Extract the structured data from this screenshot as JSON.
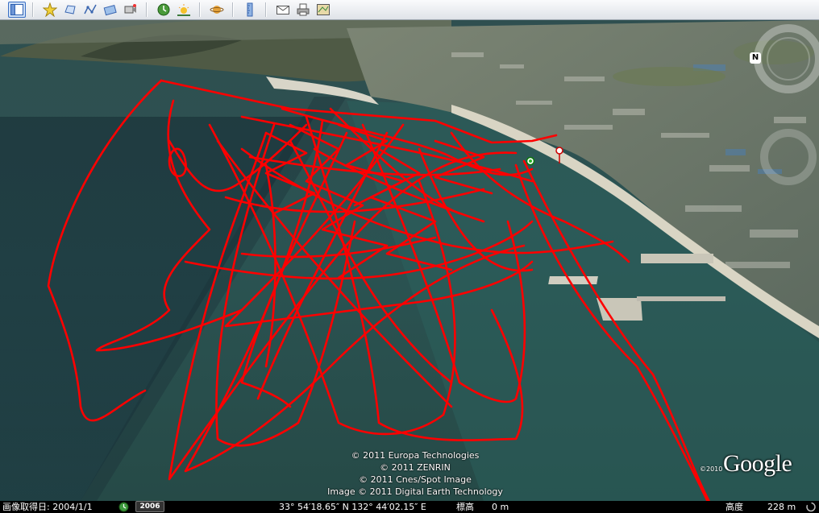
{
  "toolbar": {
    "buttons": [
      {
        "name": "sidebar-toggle-icon"
      },
      {
        "name": "add-placemark-icon"
      },
      {
        "name": "add-polygon-icon"
      },
      {
        "name": "add-path-icon"
      },
      {
        "name": "add-image-overlay-icon"
      },
      {
        "name": "record-tour-icon"
      },
      {
        "name": "historical-imagery-icon"
      },
      {
        "name": "sunlight-icon"
      },
      {
        "name": "planets-icon"
      },
      {
        "name": "ruler-icon"
      },
      {
        "name": "email-icon"
      },
      {
        "name": "print-icon"
      },
      {
        "name": "view-in-maps-icon"
      }
    ]
  },
  "map": {
    "copyright_lines": [
      "© 2011 Europa Technologies",
      "© 2011 ZENRIN",
      "© 2011 Cnes/Spot Image",
      "Image © 2011 Digital Earth Technology"
    ],
    "logo_text": "Google",
    "logo_year": "©2010",
    "compass_letter": "N",
    "colors": {
      "track": "#ff0000",
      "sea": "#2d5856",
      "land": "#6f7868"
    }
  },
  "statusbar": {
    "imagery_date": "画像取得日: 2004/1/1",
    "timeline_year": "2006",
    "coords": "33° 54′18.65″ N 132° 44′02.15″ E",
    "elev_label": "標高",
    "elev_value": "0 m",
    "alt_label": "高度",
    "alt_value": "228 m"
  }
}
